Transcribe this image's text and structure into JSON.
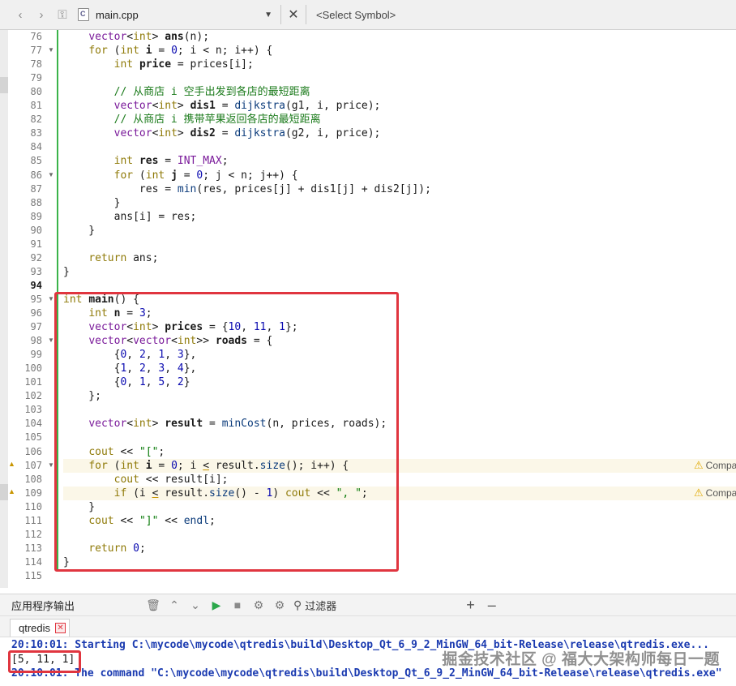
{
  "toolbar": {
    "file_name": "main.cpp",
    "symbol_placeholder": "<Select Symbol>"
  },
  "editor": {
    "lines": [
      {
        "n": "76",
        "h": "    <span class=\"tp\">vector</span>&lt;<span class=\"ty\">int</span>&gt; <span class=\"var\">ans</span>(n);"
      },
      {
        "n": "77",
        "fold": true,
        "h": "    <span class=\"kw\">for</span> (<span class=\"ty\">int</span> <span class=\"var\">i</span> = <span class=\"nm\">0</span>; i &lt; n; i++) {"
      },
      {
        "n": "78",
        "h": "        <span class=\"ty\">int</span> <span class=\"var\">price</span> = prices[i];"
      },
      {
        "n": "79",
        "h": ""
      },
      {
        "n": "80",
        "h": "        <span class=\"cm\">// 从商店 i 空手出发到各店的最短距离</span>"
      },
      {
        "n": "81",
        "h": "        <span class=\"tp\">vector</span>&lt;<span class=\"ty\">int</span>&gt; <span class=\"var\">dis1</span> = <span class=\"fn\">dijkstra</span>(g1, i, price);"
      },
      {
        "n": "82",
        "h": "        <span class=\"cm\">// 从商店 i 携带苹果返回各店的最短距离</span>"
      },
      {
        "n": "83",
        "h": "        <span class=\"tp\">vector</span>&lt;<span class=\"ty\">int</span>&gt; <span class=\"var\">dis2</span> = <span class=\"fn\">dijkstra</span>(g2, i, price);"
      },
      {
        "n": "84",
        "h": ""
      },
      {
        "n": "85",
        "h": "        <span class=\"ty\">int</span> <span class=\"var\">res</span> = <span class=\"mac\">INT_MAX</span>;"
      },
      {
        "n": "86",
        "fold": true,
        "h": "        <span class=\"kw\">for</span> (<span class=\"ty\">int</span> <span class=\"var\">j</span> = <span class=\"nm\">0</span>; j &lt; n; j++) {"
      },
      {
        "n": "87",
        "h": "            res = <span class=\"fn\">min</span>(res, prices[j] + dis1[j] + dis2[j]);"
      },
      {
        "n": "88",
        "h": "        }"
      },
      {
        "n": "89",
        "h": "        ans[i] = res;"
      },
      {
        "n": "90",
        "h": "    }"
      },
      {
        "n": "91",
        "h": ""
      },
      {
        "n": "92",
        "h": "    <span class=\"kw\">return</span> ans;"
      },
      {
        "n": "93",
        "h": "}"
      },
      {
        "n": "94",
        "bold": true,
        "h": ""
      },
      {
        "n": "95",
        "fold": true,
        "h": "<span class=\"ty\">int</span> <span class=\"var\">main</span>() {"
      },
      {
        "n": "96",
        "h": "    <span class=\"ty\">int</span> <span class=\"var\">n</span> = <span class=\"nm\">3</span>;"
      },
      {
        "n": "97",
        "h": "    <span class=\"tp\">vector</span>&lt;<span class=\"ty\">int</span>&gt; <span class=\"var\">prices</span> = {<span class=\"nm\">10</span>, <span class=\"nm\">11</span>, <span class=\"nm\">1</span>};"
      },
      {
        "n": "98",
        "fold": true,
        "h": "    <span class=\"tp\">vector</span>&lt;<span class=\"tp\">vector</span>&lt;<span class=\"ty\">int</span>&gt;&gt; <span class=\"var\">roads</span> = {"
      },
      {
        "n": "99",
        "h": "        {<span class=\"nm\">0</span>, <span class=\"nm\">2</span>, <span class=\"nm\">1</span>, <span class=\"nm\">3</span>},"
      },
      {
        "n": "100",
        "h": "        {<span class=\"nm\">1</span>, <span class=\"nm\">2</span>, <span class=\"nm\">3</span>, <span class=\"nm\">4</span>},"
      },
      {
        "n": "101",
        "h": "        {<span class=\"nm\">0</span>, <span class=\"nm\">1</span>, <span class=\"nm\">5</span>, <span class=\"nm\">2</span>}"
      },
      {
        "n": "102",
        "h": "    };"
      },
      {
        "n": "103",
        "h": ""
      },
      {
        "n": "104",
        "h": "    <span class=\"tp\">vector</span>&lt;<span class=\"ty\">int</span>&gt; <span class=\"var\">result</span> = <span class=\"fn\">minCost</span>(n, prices, roads);"
      },
      {
        "n": "105",
        "h": ""
      },
      {
        "n": "106",
        "h": "    <span class=\"kw\">cout</span> &lt;&lt; <span class=\"str\">\"[\"</span>;"
      },
      {
        "n": "107",
        "fold": true,
        "warn": true,
        "h": "    <span class=\"kw\">for</span> (<span class=\"ty\">int</span> <span class=\"var\">i</span> = <span class=\"nm\">0</span>; i <span class=\"under\">&lt;</span> result.<span class=\"fn\">size</span>(); i++) {"
      },
      {
        "n": "108",
        "h": "        <span class=\"kw\">cout</span> &lt;&lt; result[i];"
      },
      {
        "n": "109",
        "warn": true,
        "h": "        <span class=\"kw\">if</span> (i <span class=\"under\">&lt;</span> result.<span class=\"fn\">size</span>() - <span class=\"nm\">1</span>) <span class=\"kw\">cout</span> &lt;&lt; <span class=\"str\">\", \"</span>;"
      },
      {
        "n": "110",
        "h": "    }"
      },
      {
        "n": "111",
        "h": "    <span class=\"kw\">cout</span> &lt;&lt; <span class=\"str\">\"]\"</span> &lt;&lt; <span class=\"fn\">endl</span>;"
      },
      {
        "n": "112",
        "h": ""
      },
      {
        "n": "113",
        "h": "    <span class=\"kw\">return</span> <span class=\"nm\">0</span>;"
      },
      {
        "n": "114",
        "h": "}"
      },
      {
        "n": "115",
        "h": ""
      }
    ],
    "warning_label": "Compa"
  },
  "output_pane": {
    "title": "应用程序输出",
    "filter_label": "过滤器",
    "tab_label": "qtredis",
    "line1": "20:10:01: Starting C:\\mycode\\mycode\\qtredis\\build\\Desktop_Qt_6_9_2_MinGW_64_bit-Release\\release\\qtredis.exe...",
    "line2": "[5, 11, 1]",
    "line3": "20:10:01: The command \"C:\\mycode\\mycode\\qtredis\\build\\Desktop_Qt_6_9_2_MinGW_64_bit-Release\\release\\qtredis.exe\"",
    "watermark": "掘金技术社区 @ 福大大架构师每日一题"
  }
}
